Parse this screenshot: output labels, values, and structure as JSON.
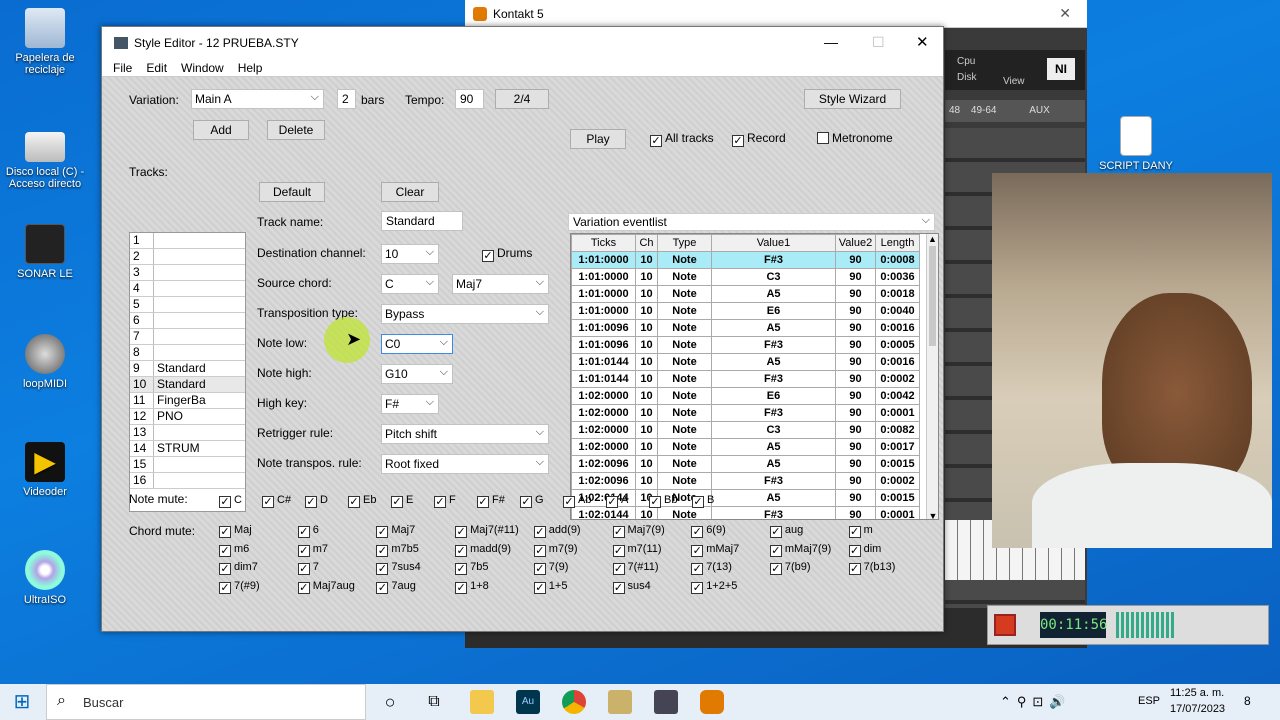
{
  "desktop": {
    "icons": [
      {
        "label": "Papelera de reciclaje"
      },
      {
        "label": "Disco local (C) - Acceso directo"
      },
      {
        "label": "SONAR LE"
      },
      {
        "label": "loopMIDI"
      },
      {
        "label": "Videoder"
      },
      {
        "label": "UltraISO"
      },
      {
        "label": "SCRIPT DANY"
      }
    ]
  },
  "kontakt": {
    "title": "Kontakt 5",
    "cpu": "Cpu",
    "disk": "Disk",
    "view": "View",
    "r1": "48",
    "r2": "49-64",
    "aux": "AUX"
  },
  "window": {
    "title": "Style Editor - 12 PRUEBA.STY",
    "menu": [
      "File",
      "Edit",
      "Window",
      "Help"
    ]
  },
  "top": {
    "variation_label": "Variation:",
    "variation": "Main A",
    "bars_value": "2",
    "bars_label": "bars",
    "tempo_label": "Tempo:",
    "tempo": "90",
    "timesig": "2/4",
    "style_wizard": "Style Wizard",
    "add": "Add",
    "delete": "Delete",
    "play": "Play",
    "all_tracks": "All tracks",
    "record": "Record",
    "metronome": "Metronome"
  },
  "tracks": {
    "label": "Tracks:",
    "rows": [
      {
        "n": "1",
        "t": ""
      },
      {
        "n": "2",
        "t": ""
      },
      {
        "n": "3",
        "t": ""
      },
      {
        "n": "4",
        "t": ""
      },
      {
        "n": "5",
        "t": ""
      },
      {
        "n": "6",
        "t": ""
      },
      {
        "n": "7",
        "t": ""
      },
      {
        "n": "8",
        "t": ""
      },
      {
        "n": "9",
        "t": "Standard"
      },
      {
        "n": "10",
        "t": "Standard"
      },
      {
        "n": "11",
        "t": "FingerBa"
      },
      {
        "n": "12",
        "t": "PNO"
      },
      {
        "n": "13",
        "t": ""
      },
      {
        "n": "14",
        "t": "STRUM"
      },
      {
        "n": "15",
        "t": ""
      },
      {
        "n": "16",
        "t": ""
      }
    ]
  },
  "track_props": {
    "default": "Default",
    "clear": "Clear",
    "name_label": "Track name:",
    "name": "Standard",
    "dest_label": "Destination channel:",
    "dest": "10",
    "drums": "Drums",
    "src_label": "Source chord:",
    "src_root": "C",
    "src_type": "Maj7",
    "transp_label": "Transposition type:",
    "transp": "Bypass",
    "low_label": "Note low:",
    "low": "C0",
    "high_label": "Note high:",
    "high": "G10",
    "key_label": "High key:",
    "key": "F#",
    "retrig_label": "Retrigger rule:",
    "retrig": "Pitch shift",
    "ntr_label": "Note transpos. rule:",
    "ntr": "Root fixed"
  },
  "eventlist": {
    "label": "Variation eventlist",
    "columns": [
      "Ticks",
      "Ch",
      "Type",
      "Value1",
      "Value2",
      "Length"
    ],
    "rows": [
      [
        "1:01:0000",
        "10",
        "Note",
        "F#3",
        "90",
        "0:0008"
      ],
      [
        "1:01:0000",
        "10",
        "Note",
        "C3",
        "90",
        "0:0036"
      ],
      [
        "1:01:0000",
        "10",
        "Note",
        "A5",
        "90",
        "0:0018"
      ],
      [
        "1:01:0000",
        "10",
        "Note",
        "E6",
        "90",
        "0:0040"
      ],
      [
        "1:01:0096",
        "10",
        "Note",
        "A5",
        "90",
        "0:0016"
      ],
      [
        "1:01:0096",
        "10",
        "Note",
        "F#3",
        "90",
        "0:0005"
      ],
      [
        "1:01:0144",
        "10",
        "Note",
        "A5",
        "90",
        "0:0016"
      ],
      [
        "1:01:0144",
        "10",
        "Note",
        "F#3",
        "90",
        "0:0002"
      ],
      [
        "1:02:0000",
        "10",
        "Note",
        "E6",
        "90",
        "0:0042"
      ],
      [
        "1:02:0000",
        "10",
        "Note",
        "F#3",
        "90",
        "0:0001"
      ],
      [
        "1:02:0000",
        "10",
        "Note",
        "C3",
        "90",
        "0:0082"
      ],
      [
        "1:02:0000",
        "10",
        "Note",
        "A5",
        "90",
        "0:0017"
      ],
      [
        "1:02:0096",
        "10",
        "Note",
        "A5",
        "90",
        "0:0015"
      ],
      [
        "1:02:0096",
        "10",
        "Note",
        "F#3",
        "90",
        "0:0002"
      ],
      [
        "1:02:0144",
        "10",
        "Note",
        "A5",
        "90",
        "0:0015"
      ],
      [
        "1:02:0144",
        "10",
        "Note",
        "F#3",
        "90",
        "0:0001"
      ]
    ]
  },
  "note_mute": {
    "label": "Note mute:",
    "items": [
      "C",
      "C#",
      "D",
      "Eb",
      "E",
      "F",
      "F#",
      "G",
      "Ab",
      "A",
      "Bb",
      "B"
    ]
  },
  "chord_mute": {
    "label": "Chord mute:",
    "items": [
      "Maj",
      "6",
      "Maj7",
      "Maj7(#11)",
      "add(9)",
      "Maj7(9)",
      "6(9)",
      "aug",
      "m",
      "m6",
      "m7",
      "m7b5",
      "madd(9)",
      "m7(9)",
      "m7(11)",
      "mMaj7",
      "mMaj7(9)",
      "dim",
      "dim7",
      "7",
      "7sus4",
      "7b5",
      "7(9)",
      "7(#11)",
      "7(13)",
      "7(b9)",
      "7(b13)",
      "7(#9)",
      "Maj7aug",
      "7aug",
      "1+8",
      "1+5",
      "sus4",
      "1+2+5"
    ]
  },
  "recorder": {
    "time": "00:11:56"
  },
  "taskbar": {
    "search": "Buscar",
    "lang": "ESP",
    "time": "11:25 a. m.",
    "date": "17/07/2023",
    "notif": "8"
  }
}
